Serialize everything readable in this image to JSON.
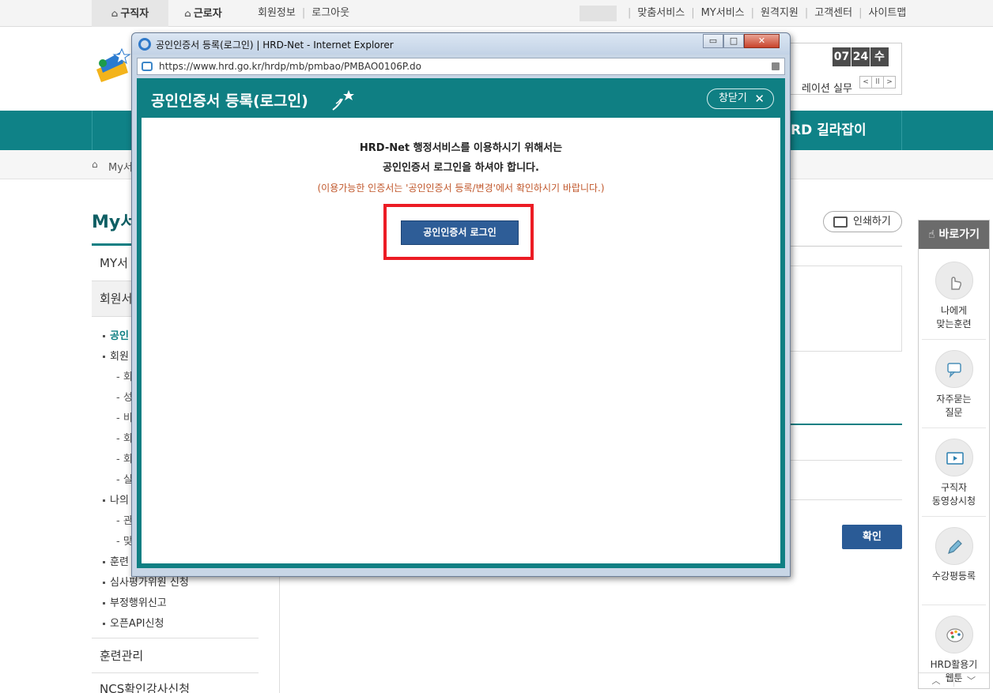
{
  "topbar": {
    "tab_jobseeker": "구직자",
    "tab_worker": "근로자",
    "link_member_info": "회원정보",
    "link_logout": "로그아웃",
    "right_links": [
      "맞춤서비스",
      "MY서비스",
      "원격지원",
      "고객센터",
      "사이트맵"
    ]
  },
  "header": {
    "clock": {
      "hour": "07",
      "minute": "24",
      "day": "수"
    },
    "news_text": "레이션 실무"
  },
  "gnb": {
    "visible_item": "RD 길라잡이"
  },
  "breadcrumb": {
    "text": "My서"
  },
  "lnb": {
    "title": "My서",
    "sections": [
      {
        "label": "MY서"
      },
      {
        "label": "회원서"
      }
    ],
    "items": [
      {
        "label": "공인",
        "active": true
      },
      {
        "label": "회원"
      }
    ],
    "subs": [
      "- 회",
      "- 성",
      "- 비",
      "- 회",
      "- 회",
      "- 실"
    ],
    "items2": [
      {
        "label": "나의"
      }
    ],
    "subs2": [
      "- 관",
      "- 맞"
    ],
    "items3": [
      {
        "label": "훈련"
      },
      {
        "label": "심사평가위원 신청"
      },
      {
        "label": "부정행위신고"
      },
      {
        "label": "오픈API신청"
      }
    ],
    "bottom_sections": [
      {
        "label": "훈련관리"
      },
      {
        "label": "NCS확인강사신청"
      }
    ]
  },
  "content": {
    "print_label": "인쇄하기",
    "confirm_label": "확인"
  },
  "quickmenu": {
    "title": "바로가기",
    "items": [
      {
        "label": "나에게\n맞는훈련",
        "icon": "hand-pointer-icon"
      },
      {
        "label": "자주묻는\n질문",
        "icon": "chat-bubbles-icon"
      },
      {
        "label": "구직자\n동영상시청",
        "icon": "video-player-icon"
      },
      {
        "label": "수강평등록",
        "icon": "pencil-icon"
      },
      {
        "label": "HRD활용기\n웹툰",
        "icon": "palette-icon"
      }
    ],
    "up": "︿",
    "down": "﹀"
  },
  "ie_window": {
    "title": "공인인증서 등록(로그인) | HRD-Net - Internet Explorer",
    "url": "https://www.hrd.go.kr/hrdp/mb/pmbao/PMBAO0106P.do",
    "btn_min": "▭",
    "btn_max": "□",
    "btn_close": "✕"
  },
  "popup": {
    "title": "공인인증서 등록(로그인)",
    "close_label": "창닫기",
    "close_x": "✕",
    "message_line1": "HRD-Net 행정서비스를 이용하시기 위해서는",
    "message_line2": "공인인증서 로그인을 하셔야 합니다.",
    "note": "(이용가능한 인증서는 '공인인증서 등록/변경'에서 확인하시기 바랍니다.)",
    "login_button": "공인인증서 로그인"
  },
  "colors": {
    "brand_teal": "#0f7f83",
    "button_blue": "#2e5d97",
    "highlight_red": "#ec1c24",
    "note_orange": "#c0562a"
  }
}
